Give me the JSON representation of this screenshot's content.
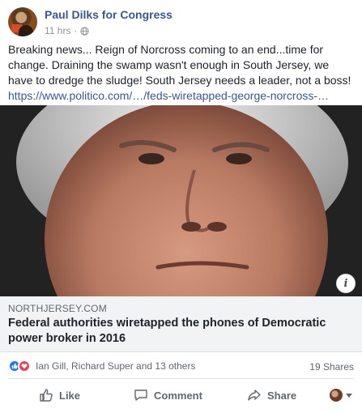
{
  "post": {
    "author": "Paul Dilks for Congress",
    "timestamp": "11 hrs",
    "separator": "·",
    "privacy_icon": "globe-icon",
    "text": "Breaking news... Reign of Norcross coming to an end...time for change. Draining the swamp wasn't enough in South Jersey, we have to dredge the sludge! South Jersey needs a leader, not a boss!",
    "link_text": "https://www.politico.com/…/feds-wiretapped-george-norcross-…"
  },
  "preview": {
    "domain": "NORTHJERSEY.COM",
    "headline": "Federal authorities wiretapped the phones of Democratic power broker in 2016",
    "info_icon": "i"
  },
  "engagement": {
    "reactors": "Ian Gill, Richard Super and 13 others",
    "shares": "19 Shares"
  },
  "actions": {
    "like": "Like",
    "comment": "Comment",
    "share": "Share"
  },
  "colors": {
    "link": "#365899",
    "like_blue": "#1877f2",
    "love_red": "#f33e58",
    "preview_bg": "#f2f3f5"
  }
}
